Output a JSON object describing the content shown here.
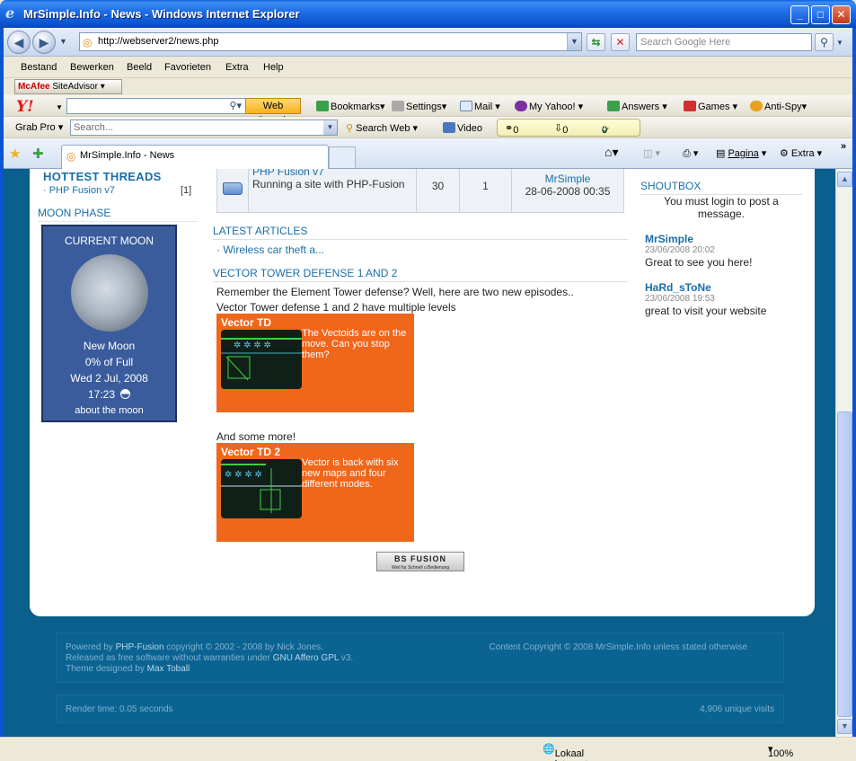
{
  "window": {
    "title": "MrSimple.Info - News - Windows Internet Explorer"
  },
  "address": {
    "url": "http://webserver2/news.php",
    "search_placeholder": "Search Google Here"
  },
  "menu": [
    "Bestand",
    "Bewerken",
    "Beeld",
    "Favorieten",
    "Extra",
    "Help"
  ],
  "mcafee": {
    "brand": "McAfee",
    "label": "SiteAdvisor"
  },
  "yahoo_toolbar": {
    "logo": "Y!",
    "web_search": "Web Search",
    "bookmarks": "Bookmarks",
    "settings": "Settings",
    "mail": "Mail",
    "my_yahoo": "My Yahoo!",
    "answers": "Answers",
    "games": "Games",
    "anti_spy": "Anti-Spy"
  },
  "grab_toolbar": {
    "label": "Grab Pro",
    "search_placeholder": "Search...",
    "search_web": "Search Web",
    "video": "Video",
    "counts": [
      "0",
      "0",
      "0"
    ]
  },
  "tabs": {
    "active": "MrSimple.Info - News",
    "pagina": "Pagina",
    "extra": "Extra"
  },
  "left": {
    "hottest_title": "HOTTEST THREADS",
    "thread": "· PHP Fusion v7",
    "thread_count": "[1]",
    "moon_title": "MOON PHASE",
    "moon": {
      "heading": "CURRENT MOON",
      "phase": "New Moon",
      "full": "0% of Full",
      "date": "Wed 2 Jul, 2008",
      "time": "17:23",
      "about": "about the moon"
    }
  },
  "forum_row": {
    "forum": "PHP Fusion v7",
    "topic": "Running a site with PHP-Fusion",
    "views": "30",
    "replies": "1",
    "author": "MrSimple",
    "date": "28-06-2008 00:35"
  },
  "articles": {
    "title": "LATEST ARTICLES",
    "item": "· Wireless car theft a..."
  },
  "news": {
    "title": "VECTOR TOWER DEFENSE 1 AND 2",
    "intro": "Remember the Element Tower defense? Well, here are two new episodes.. Vector Tower defense 1 and 2 have multiple levels",
    "promo1_title": "Vector TD",
    "promo1_text": "The Vectoids are on the move. Can you stop them?",
    "more": "And some more!",
    "promo2_title": "Vector TD 2",
    "promo2_text": "Vector is back with six new maps and four different modes.",
    "badge": "BS FUSION",
    "badge_sub": "Weil fur Schnell u Bedienung"
  },
  "shoutbox": {
    "title": "SHOUTBOX",
    "login_msg": "You must login to post a message.",
    "posts": [
      {
        "user": "MrSimple",
        "date": "23/06/2008 20:02",
        "msg": "Great to see you here!"
      },
      {
        "user": "HaRd_sToNe",
        "date": "23/06/2008 19:53",
        "msg": "great to visit your website"
      }
    ]
  },
  "footer": {
    "powered": "Powered by",
    "php_fusion": "PHP-Fusion",
    "copyright": "copyright © 2002 - 2008 by Nick Jones.",
    "released": "Released as free software without warranties under",
    "gpl": "GNU Affero GPL",
    "v3": "v3.",
    "theme": "Theme designed by",
    "designer": "Max Toball",
    "content_copyright": "Content Copyright © 2008 MrSimple.Info unless stated otherwise",
    "render_time": "Render time: 0.05 seconds",
    "visits": "4,906 unique visits"
  },
  "status": {
    "zone": "Lokaal intranet",
    "zoom": "100%"
  }
}
